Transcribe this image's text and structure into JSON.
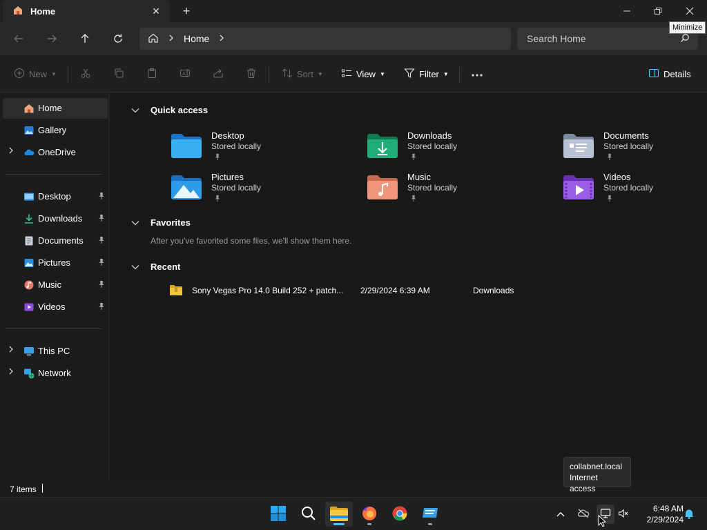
{
  "window": {
    "tab_title": "Home",
    "minimize_tooltip": "Minimize"
  },
  "address": {
    "crumb": "Home",
    "search_placeholder": "Search Home"
  },
  "commands": {
    "new": "New",
    "sort": "Sort",
    "view": "View",
    "filter": "Filter",
    "details": "Details"
  },
  "sidebar": {
    "top": [
      {
        "label": "Home",
        "icon": "home-icon",
        "selected": true
      },
      {
        "label": "Gallery",
        "icon": "gallery-icon"
      },
      {
        "label": "OneDrive",
        "icon": "onedrive-icon",
        "expandable": true
      }
    ],
    "pinned": [
      {
        "label": "Desktop",
        "icon": "desktop-folder-icon"
      },
      {
        "label": "Downloads",
        "icon": "downloads-folder-icon"
      },
      {
        "label": "Documents",
        "icon": "documents-folder-icon"
      },
      {
        "label": "Pictures",
        "icon": "pictures-folder-icon"
      },
      {
        "label": "Music",
        "icon": "music-folder-icon"
      },
      {
        "label": "Videos",
        "icon": "videos-folder-icon"
      }
    ],
    "bottom": [
      {
        "label": "This PC",
        "icon": "this-pc-icon"
      },
      {
        "label": "Network",
        "icon": "network-icon"
      }
    ]
  },
  "content": {
    "quick_access": {
      "title": "Quick access",
      "items": [
        {
          "name": "Desktop",
          "sub": "Stored locally"
        },
        {
          "name": "Downloads",
          "sub": "Stored locally"
        },
        {
          "name": "Documents",
          "sub": "Stored locally"
        },
        {
          "name": "Pictures",
          "sub": "Stored locally"
        },
        {
          "name": "Music",
          "sub": "Stored locally"
        },
        {
          "name": "Videos",
          "sub": "Stored locally"
        }
      ]
    },
    "favorites": {
      "title": "Favorites",
      "empty_text": "After you've favorited some files, we'll show them here."
    },
    "recent": {
      "title": "Recent",
      "items": [
        {
          "name": "Sony Vegas Pro 14.0 Build 252 + patch...",
          "date": "2/29/2024 6:39 AM",
          "location": "Downloads"
        }
      ]
    }
  },
  "status": {
    "item_count": "7 items"
  },
  "taskbar": {
    "time": "6:48 AM",
    "date": "2/29/2024",
    "network_tooltip_line1": "collabnet.local",
    "network_tooltip_line2": "Internet access"
  },
  "colors": {
    "accent": "#4cc2ff",
    "background": "#191919",
    "folder_blue": "#3aa0e8",
    "folder_green": "#1e9b6e",
    "folder_purple": "#8b4bdc",
    "folder_orange": "#e88a5c"
  }
}
